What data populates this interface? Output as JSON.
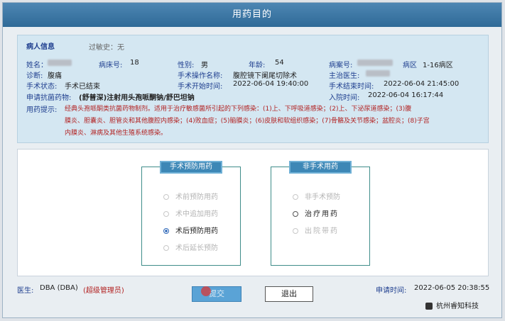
{
  "window": {
    "title": "用药目的"
  },
  "patient": {
    "section_title": "病人信息",
    "allergy": "过敏史：无",
    "name_label": "姓名：",
    "bed_label": "病床号:",
    "bed_value": "18",
    "gender_label": "性别:",
    "gender_value": "男",
    "age_label": "年龄:",
    "age_value": "54",
    "record_label": "病案号:",
    "ward_label": "病区",
    "ward_value": "1-16病区",
    "diagnosis_label": "诊断:",
    "diagnosis_value": "腹痛",
    "op_name_label": "手术操作名称:",
    "op_name_value": "腹腔镜下阑尾切除术",
    "attending_label": "主治医生:",
    "op_status_label": "手术状态:",
    "op_status_value": "手术已结束",
    "op_start_label": "手术开始时间:",
    "op_start_value": "2022-06-04 19:40:00",
    "op_end_label": "手术结束时间:",
    "op_end_value": "2022-06-04 21:45:00",
    "drug_label": "申请抗菌药物:",
    "drug_value": "(舒普深)注射用头孢哌酮钠/舒巴坦钠",
    "admit_label": "入院时间:",
    "admit_value": "2022-06-04 16:17:44",
    "hint_label": "用药提示:",
    "hint_line1": "经典头孢哌酮类抗菌药物制剂。适用于治疗敏感菌所引起的下列感染：(1)上、下呼吸道感染；(2)上、下泌尿道感染；(3)腹",
    "hint_line2": "膜炎、胆囊炎、胆管炎和其他腹腔内感染；(4)败血症；(5)脑膜炎；(6)皮肤和软组织感染；(7)骨骼及关节感染；盆腔炎；(8)子宫",
    "hint_line3": "内膜炎、淋病及其他生殖系统感染。"
  },
  "surgical_group": {
    "title": "手术预防用药",
    "options": [
      {
        "label": "术前预防用药",
        "state": "disabled"
      },
      {
        "label": "术中追加用药",
        "state": "disabled"
      },
      {
        "label": "术后预防用药",
        "state": "checked"
      },
      {
        "label": "术后延长预防",
        "state": "disabled"
      }
    ]
  },
  "nonsurgical_group": {
    "title": "非手术用药",
    "options": [
      {
        "label": "非手术预防",
        "state": "disabled"
      },
      {
        "label": "治疗用药",
        "state": "enabled"
      },
      {
        "label": "出院带药",
        "state": "disabled"
      }
    ]
  },
  "footer": {
    "doctor_label": "医生:",
    "doctor_value": "DBA (DBA)",
    "doctor_role": "(超级管理员)",
    "submit_label": "提交",
    "exit_label": "退出",
    "request_time_label": "申请时间:",
    "request_time_value": "2022-06-05 20:38:55",
    "company": "杭州睿知科技"
  },
  "colors": {
    "accent": "#3d87b6",
    "title_bar": "#2f6a97",
    "hint_red": "#b22222"
  }
}
